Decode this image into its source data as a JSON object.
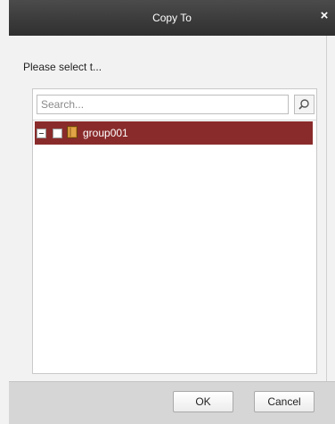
{
  "dialog": {
    "title": "Copy To",
    "close_symbol": "×",
    "prompt": "Please select t..."
  },
  "search": {
    "placeholder": "Search...",
    "value": "",
    "icon": "search-icon"
  },
  "tree": {
    "items": [
      {
        "label": "group001",
        "expanded": true,
        "checked": false,
        "selected": true,
        "icon": "group-folder-icon"
      }
    ]
  },
  "footer": {
    "ok_label": "OK",
    "cancel_label": "Cancel"
  },
  "colors": {
    "titlebar": "#3a3a3a",
    "selection": "#8a2b2b",
    "background": "#f2f2f2",
    "footer": "#d6d6d6"
  }
}
